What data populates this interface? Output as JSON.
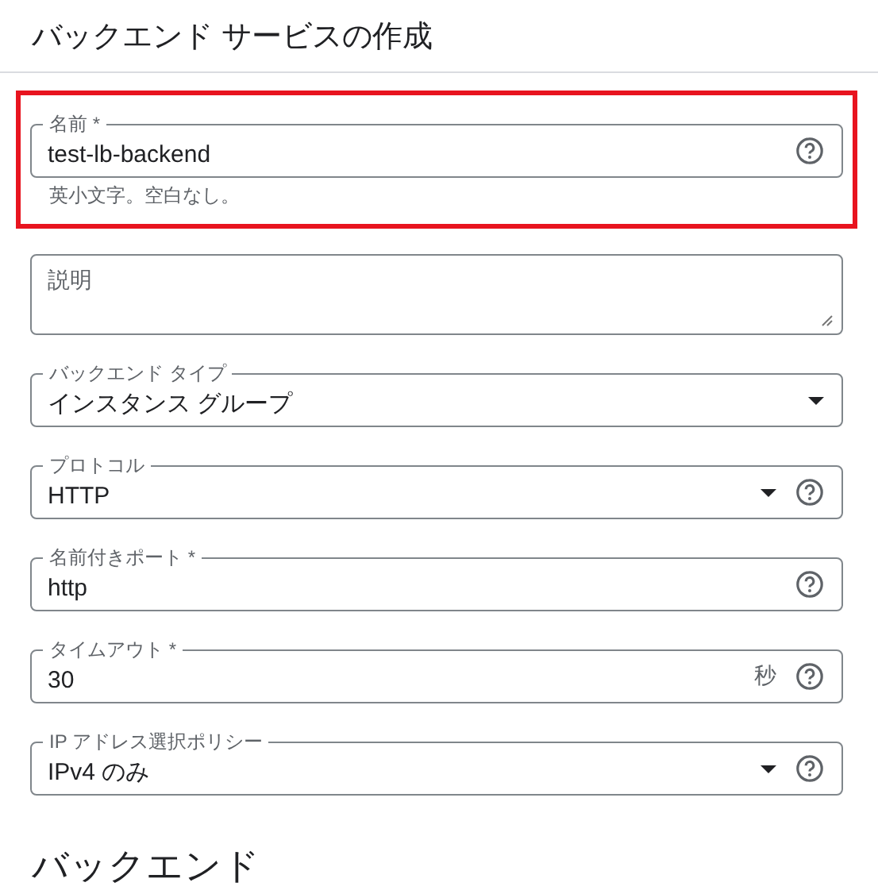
{
  "page": {
    "title": "バックエンド サービスの作成"
  },
  "fields": [
    {
      "kind": "text",
      "label": "名前 *",
      "value": "test-lb-backend",
      "help": true,
      "hint": "英小文字。空白なし。",
      "highlighted": true
    },
    {
      "kind": "textarea",
      "label": "説明",
      "help": false,
      "highlighted": false
    },
    {
      "kind": "select",
      "label": "バックエンド タイプ",
      "value": "インスタンス グループ",
      "help": false,
      "highlighted": false
    },
    {
      "kind": "select",
      "label": "プロトコル",
      "value": "HTTP",
      "help": true,
      "highlighted": false
    },
    {
      "kind": "text",
      "label": "名前付きポート *",
      "value": "http",
      "help": true,
      "highlighted": false
    },
    {
      "kind": "text",
      "label": "タイムアウト *",
      "value": "30",
      "suffix": "秒",
      "help": true,
      "highlighted": false
    },
    {
      "kind": "select",
      "label": "IP アドレス選択ポリシー",
      "value": "IPv4 のみ",
      "help": true,
      "highlighted": false
    }
  ],
  "section": {
    "title": "バックエンド"
  }
}
